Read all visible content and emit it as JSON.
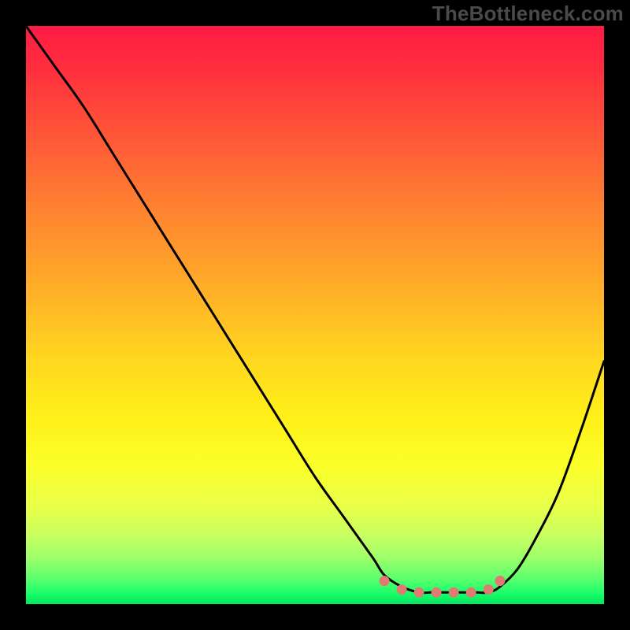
{
  "watermark": "TheBottleneck.com",
  "chart_data": {
    "type": "line",
    "title": "",
    "xlabel": "",
    "ylabel": "",
    "xlim": [
      0,
      100
    ],
    "ylim": [
      0,
      100
    ],
    "series": [
      {
        "name": "bottleneck-curve",
        "x": [
          0,
          5,
          10,
          15,
          20,
          25,
          30,
          35,
          40,
          45,
          50,
          55,
          60,
          62,
          65,
          68,
          70,
          72,
          75,
          78,
          80,
          82,
          85,
          88,
          92,
          96,
          100
        ],
        "y": [
          100,
          93,
          86,
          78,
          70,
          62,
          54,
          46,
          38,
          30,
          22,
          15,
          8,
          5,
          3,
          2,
          2,
          2,
          2,
          2,
          2,
          3,
          6,
          11,
          19,
          30,
          42
        ]
      }
    ],
    "markers": {
      "name": "valley-markers",
      "color": "#e07a72",
      "points": [
        {
          "x": 62,
          "y": 4
        },
        {
          "x": 65,
          "y": 2.5
        },
        {
          "x": 68,
          "y": 2
        },
        {
          "x": 71,
          "y": 2
        },
        {
          "x": 74,
          "y": 2
        },
        {
          "x": 77,
          "y": 2
        },
        {
          "x": 80,
          "y": 2.5
        },
        {
          "x": 82,
          "y": 4
        }
      ]
    },
    "gradient_stops": [
      {
        "pos": 0,
        "color": "#ff1b44"
      },
      {
        "pos": 55,
        "color": "#ffd81f"
      },
      {
        "pos": 85,
        "color": "#e9ff48"
      },
      {
        "pos": 100,
        "color": "#00e85e"
      }
    ]
  }
}
